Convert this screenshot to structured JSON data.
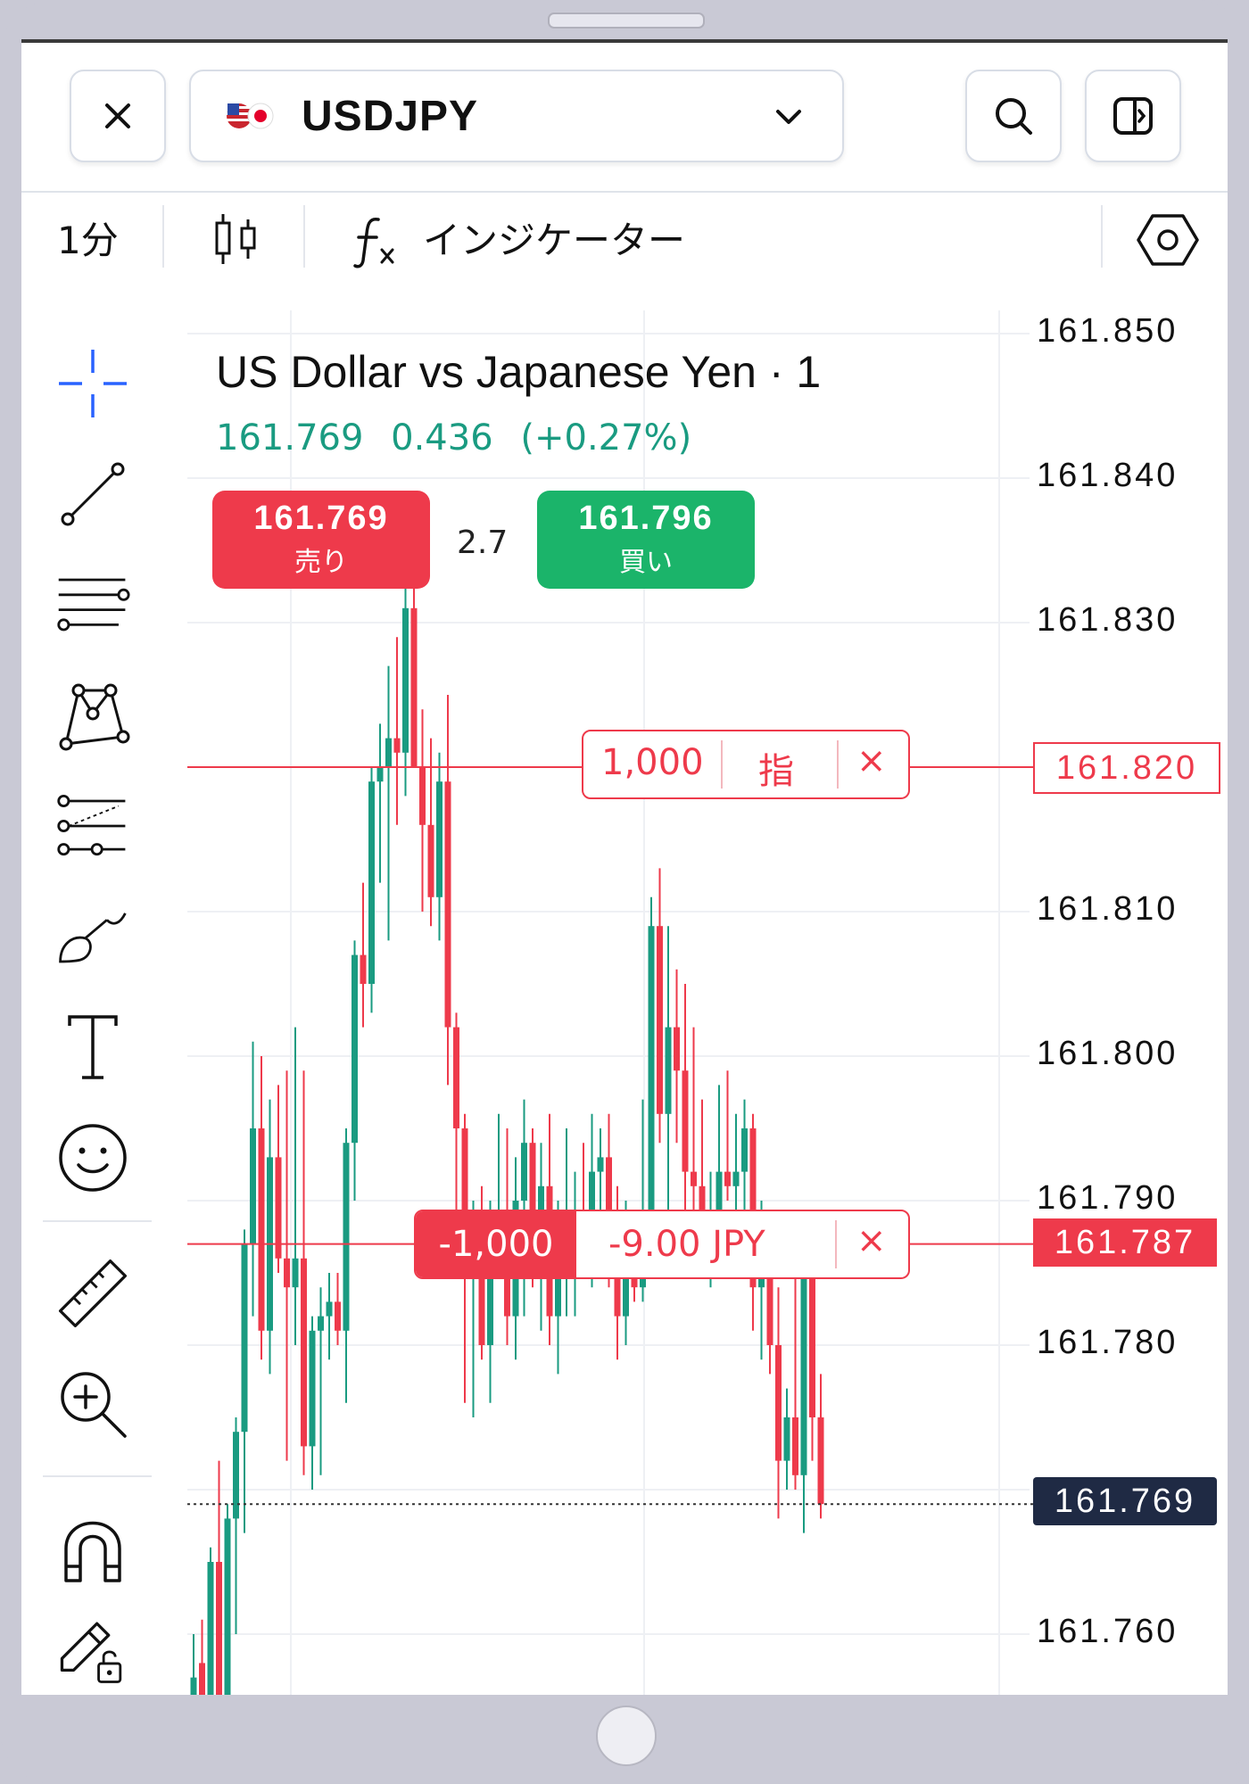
{
  "header": {
    "symbol": "USDJPY",
    "close_icon": "close-icon",
    "search_icon": "search-icon",
    "panel_icon": "panel-toggle-icon",
    "dropdown_icon": "chevron-down-icon"
  },
  "toolbar": {
    "interval": "1分",
    "chart_type_icon": "candlestick-icon",
    "indicators_label": "インジケーター",
    "settings_icon": "settings-hexagon-icon"
  },
  "left_tools": [
    "crosshair-icon",
    "trend-line-icon",
    "fib-retracement-icon",
    "pattern-icon",
    "projection-icon",
    "brush-icon",
    "text-icon",
    "emoji-icon",
    "ruler-icon",
    "zoom-in-icon",
    "magnet-icon",
    "lock-drawing-icon"
  ],
  "legend": {
    "title": "US Dollar vs Japanese Yen · 1",
    "last": "161.769",
    "change": "0.436",
    "change_pct": "(+0.27%)"
  },
  "trade": {
    "sell_price": "161.769",
    "sell_label": "売り",
    "spread": "2.7",
    "buy_price": "161.796",
    "buy_label": "買い"
  },
  "order_line": {
    "quantity": "1,000",
    "kind": "指",
    "close": "×",
    "price": "161.820"
  },
  "position_line": {
    "quantity": "-1,000",
    "pnl": "-9.00 JPY",
    "close": "×",
    "price": "161.787"
  },
  "current_price": "161.769",
  "colors": {
    "up": "#1a9b81",
    "down": "#ee3a4b",
    "accent": "#2962ff",
    "price_tag": "#1f2a44"
  },
  "chart_data": {
    "type": "candlestick",
    "y_ticks": [
      "161.850",
      "161.840",
      "161.830",
      "161.820",
      "161.810",
      "161.800",
      "161.790",
      "161.780",
      "161.770",
      "161.760"
    ],
    "ylim": [
      161.7555,
      161.8505
    ],
    "grid": true,
    "candles": [
      [
        161.751,
        161.76,
        161.749,
        161.757
      ],
      [
        161.758,
        161.761,
        161.751,
        161.754
      ],
      [
        161.753,
        161.766,
        161.751,
        161.765
      ],
      [
        161.765,
        161.772,
        161.75,
        161.753
      ],
      [
        161.753,
        161.769,
        161.752,
        161.768
      ],
      [
        161.768,
        161.775,
        161.76,
        161.774
      ],
      [
        161.774,
        161.788,
        161.767,
        161.787
      ],
      [
        161.787,
        161.801,
        161.782,
        161.795
      ],
      [
        161.795,
        161.8,
        161.779,
        161.781
      ],
      [
        161.781,
        161.797,
        161.778,
        161.793
      ],
      [
        161.793,
        161.798,
        161.785,
        161.786
      ],
      [
        161.786,
        161.799,
        161.772,
        161.784
      ],
      [
        161.784,
        161.802,
        161.78,
        161.786
      ],
      [
        161.786,
        161.799,
        161.771,
        161.773
      ],
      [
        161.773,
        161.782,
        161.77,
        161.781
      ],
      [
        161.781,
        161.784,
        161.771,
        161.782
      ],
      [
        161.782,
        161.785,
        161.779,
        161.783
      ],
      [
        161.783,
        161.785,
        161.78,
        161.781
      ],
      [
        161.781,
        161.795,
        161.776,
        161.794
      ],
      [
        161.794,
        161.808,
        161.79,
        161.807
      ],
      [
        161.807,
        161.812,
        161.802,
        161.805
      ],
      [
        161.805,
        161.82,
        161.803,
        161.819
      ],
      [
        161.819,
        161.823,
        161.812,
        161.82
      ],
      [
        161.82,
        161.827,
        161.808,
        161.822
      ],
      [
        161.822,
        161.829,
        161.816,
        161.821
      ],
      [
        161.821,
        161.833,
        161.818,
        161.831
      ],
      [
        161.831,
        161.838,
        161.823,
        161.82
      ],
      [
        161.82,
        161.824,
        161.81,
        161.816
      ],
      [
        161.816,
        161.822,
        161.809,
        161.811
      ],
      [
        161.811,
        161.821,
        161.808,
        161.819
      ],
      [
        161.819,
        161.825,
        161.798,
        161.802
      ],
      [
        161.802,
        161.803,
        161.788,
        161.795
      ],
      [
        161.795,
        161.796,
        161.776,
        161.785
      ],
      [
        161.785,
        161.79,
        161.775,
        161.786
      ],
      [
        161.786,
        161.791,
        161.779,
        161.78
      ],
      [
        161.78,
        161.79,
        161.776,
        161.788
      ],
      [
        161.788,
        161.796,
        161.786,
        161.789
      ],
      [
        161.789,
        161.795,
        161.78,
        161.782
      ],
      [
        161.782,
        161.793,
        161.779,
        161.79
      ],
      [
        161.79,
        161.797,
        161.782,
        161.794
      ],
      [
        161.794,
        161.795,
        161.784,
        161.788
      ],
      [
        161.788,
        161.794,
        161.781,
        161.791
      ],
      [
        161.791,
        161.796,
        161.78,
        161.782
      ],
      [
        161.782,
        161.79,
        161.778,
        161.786
      ],
      [
        161.786,
        161.795,
        161.782,
        161.787
      ],
      [
        161.787,
        161.792,
        161.782,
        161.788
      ],
      [
        161.788,
        161.794,
        161.785,
        161.786
      ],
      [
        161.786,
        161.796,
        161.784,
        161.792
      ],
      [
        161.792,
        161.795,
        161.787,
        161.793
      ],
      [
        161.793,
        161.796,
        161.784,
        161.788
      ],
      [
        161.788,
        161.791,
        161.779,
        161.782
      ],
      [
        161.782,
        161.79,
        161.78,
        161.786
      ],
      [
        161.786,
        161.789,
        161.783,
        161.784
      ],
      [
        161.784,
        161.797,
        161.783,
        161.789
      ],
      [
        161.789,
        161.811,
        161.787,
        161.809
      ],
      [
        161.809,
        161.813,
        161.794,
        161.796
      ],
      [
        161.796,
        161.809,
        161.789,
        161.802
      ],
      [
        161.802,
        161.806,
        161.794,
        161.799
      ],
      [
        161.799,
        161.805,
        161.788,
        161.792
      ],
      [
        161.792,
        161.802,
        161.786,
        161.791
      ],
      [
        161.791,
        161.797,
        161.785,
        161.786
      ],
      [
        161.786,
        161.792,
        161.784,
        161.788
      ],
      [
        161.788,
        161.798,
        161.786,
        161.792
      ],
      [
        161.792,
        161.799,
        161.79,
        161.791
      ],
      [
        161.791,
        161.796,
        161.785,
        161.792
      ],
      [
        161.792,
        161.797,
        161.786,
        161.795
      ],
      [
        161.795,
        161.796,
        161.781,
        161.784
      ],
      [
        161.784,
        161.79,
        161.779,
        161.787
      ],
      [
        161.787,
        161.789,
        161.778,
        161.78
      ],
      [
        161.78,
        161.784,
        161.768,
        161.772
      ],
      [
        161.772,
        161.777,
        161.77,
        161.775
      ],
      [
        161.775,
        161.786,
        161.77,
        161.771
      ],
      [
        161.771,
        161.787,
        161.767,
        161.785
      ],
      [
        161.785,
        161.786,
        161.772,
        161.775
      ],
      [
        161.775,
        161.778,
        161.768,
        161.769
      ]
    ]
  }
}
